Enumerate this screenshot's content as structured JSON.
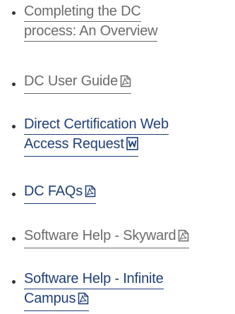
{
  "colors": {
    "link_primary": "#1f3f7a",
    "link_muted": "#6b6b6b",
    "bullet": "#333333"
  },
  "links": [
    {
      "lines": [
        "Completing the DC",
        "process: An Overview"
      ],
      "icon": null,
      "style": "muted"
    },
    {
      "lines": [
        "DC User Guide"
      ],
      "icon": "pdf-icon",
      "style": "muted"
    },
    {
      "lines": [
        "Direct Certification Web",
        "Access Request"
      ],
      "icon": "word-doc-icon",
      "style": "primary"
    },
    {
      "lines": [
        "DC FAQs"
      ],
      "icon": "pdf-icon",
      "style": "primary"
    },
    {
      "lines": [
        "Software Help - Skyward"
      ],
      "icon": "pdf-icon",
      "style": "muted"
    },
    {
      "lines": [
        "Software Help - Infinite",
        "Campus"
      ],
      "icon": "pdf-icon",
      "style": "primary"
    }
  ]
}
